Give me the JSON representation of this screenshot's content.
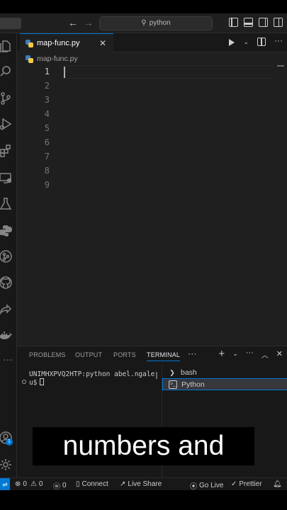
{
  "titlebar": {
    "search_text": "python",
    "icons": [
      "back-arrow-icon",
      "forward-arrow-icon",
      "search-icon",
      "toggle-primary-sidebar-icon",
      "toggle-panel-icon",
      "toggle-secondary-sidebar-icon",
      "customize-layout-icon"
    ]
  },
  "activitybar": {
    "items": [
      "explorer",
      "search",
      "source-control",
      "run-and-debug",
      "extensions",
      "remote-explorer",
      "testing",
      "python",
      "gitlens",
      "github",
      "live-share",
      "docker",
      "more"
    ],
    "bottom": [
      "accounts",
      "manage"
    ],
    "accounts_badge": "1"
  },
  "tabs": [
    {
      "label": "map-func.py",
      "icon": "python-file-icon",
      "active": true
    }
  ],
  "breadcrumb": {
    "file": "map-func.py"
  },
  "editor": {
    "line_numbers": [
      "1",
      "2",
      "3",
      "4",
      "5",
      "6",
      "7",
      "8",
      "9"
    ],
    "active_line": 1,
    "content": ""
  },
  "panel": {
    "tabs": [
      "PROBLEMS",
      "OUTPUT",
      "PORTS",
      "TERMINAL"
    ],
    "active_tab": "TERMINAL",
    "more": "···",
    "terminal": {
      "line1": "UNIMHXPVQ2HTP:python abel.ngale",
      "line2": "u$"
    },
    "terminal_list": [
      {
        "label": "bash",
        "icon": "bash-icon"
      },
      {
        "label": "Python",
        "icon": "terminal-icon",
        "selected": true
      }
    ]
  },
  "caption": "numbers and",
  "statusbar": {
    "errors": "0",
    "warnings": "0",
    "info": "0",
    "connect": "Connect",
    "live_share": "Live Share",
    "go_live": "Go Live",
    "prettier": "Prettier"
  },
  "colors": {
    "accent": "#0078d4",
    "editor_bg": "#1f1f1f",
    "panel_bg": "#181818"
  }
}
